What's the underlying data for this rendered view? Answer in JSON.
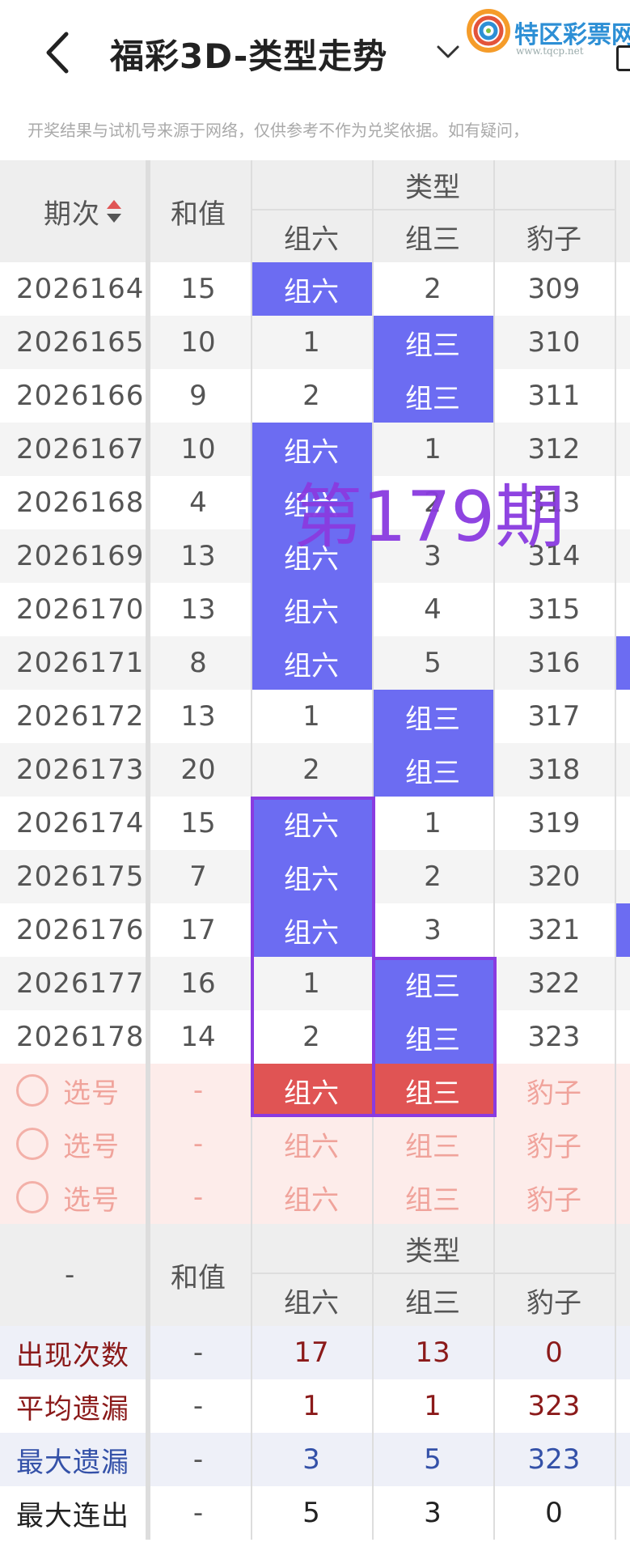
{
  "header": {
    "title": "福彩3D-类型走势",
    "logo_text": "特区彩票网",
    "logo_url": "www.tqcp.net"
  },
  "notice": "开奖结果与试机号来源于网络，仅供参考不作为兑奖依据。如有疑问，",
  "columns": {
    "issue": "期次",
    "sum": "和值",
    "type_group": "类型",
    "z6": "组六",
    "z3": "组三",
    "bz": "豹子"
  },
  "rows": [
    {
      "issue": "2026164",
      "sum": "15",
      "z6": "组六",
      "z3": "2",
      "bz": "309",
      "hit": "z6"
    },
    {
      "issue": "2026165",
      "sum": "10",
      "z6": "1",
      "z3": "组三",
      "bz": "310",
      "hit": "z3"
    },
    {
      "issue": "2026166",
      "sum": "9",
      "z6": "2",
      "z3": "组三",
      "bz": "311",
      "hit": "z3"
    },
    {
      "issue": "2026167",
      "sum": "10",
      "z6": "组六",
      "z3": "1",
      "bz": "312",
      "hit": "z6"
    },
    {
      "issue": "2026168",
      "sum": "4",
      "z6": "组六",
      "z3": "2",
      "bz": "313",
      "hit": "z6"
    },
    {
      "issue": "2026169",
      "sum": "13",
      "z6": "组六",
      "z3": "3",
      "bz": "314",
      "hit": "z6"
    },
    {
      "issue": "2026170",
      "sum": "13",
      "z6": "组六",
      "z3": "4",
      "bz": "315",
      "hit": "z6"
    },
    {
      "issue": "2026171",
      "sum": "8",
      "z6": "组六",
      "z3": "5",
      "bz": "316",
      "hit": "z6"
    },
    {
      "issue": "2026172",
      "sum": "13",
      "z6": "1",
      "z3": "组三",
      "bz": "317",
      "hit": "z3"
    },
    {
      "issue": "2026173",
      "sum": "20",
      "z6": "2",
      "z3": "组三",
      "bz": "318",
      "hit": "z3"
    },
    {
      "issue": "2026174",
      "sum": "15",
      "z6": "组六",
      "z3": "1",
      "bz": "319",
      "hit": "z6"
    },
    {
      "issue": "2026175",
      "sum": "7",
      "z6": "组六",
      "z3": "2",
      "bz": "320",
      "hit": "z6"
    },
    {
      "issue": "2026176",
      "sum": "17",
      "z6": "组六",
      "z3": "3",
      "bz": "321",
      "hit": "z6"
    },
    {
      "issue": "2026177",
      "sum": "16",
      "z6": "1",
      "z3": "组三",
      "bz": "322",
      "hit": "z3"
    },
    {
      "issue": "2026178",
      "sum": "14",
      "z6": "2",
      "z3": "组三",
      "bz": "323",
      "hit": "z3"
    }
  ],
  "pick_rows": [
    {
      "label": "选号",
      "sum": "-",
      "z6": "组六",
      "z3": "组三",
      "bz": "豹子"
    },
    {
      "label": "选号",
      "sum": "-",
      "z6": "组六",
      "z3": "组三",
      "bz": "豹子"
    },
    {
      "label": "选号",
      "sum": "-",
      "z6": "组六",
      "z3": "组三",
      "bz": "豹子"
    }
  ],
  "stats_header": {
    "issue": "-",
    "sum": "和值",
    "type_group": "类型",
    "z6": "组六",
    "z3": "组三",
    "bz": "豹子"
  },
  "stats": [
    {
      "label": "出现次数",
      "sum": "-",
      "z6": "17",
      "z3": "13",
      "bz": "0"
    },
    {
      "label": "平均遗漏",
      "sum": "-",
      "z6": "1",
      "z3": "1",
      "bz": "323"
    },
    {
      "label": "最大遗漏",
      "sum": "-",
      "z6": "3",
      "z3": "5",
      "bz": "323"
    },
    {
      "label": "最大连出",
      "sum": "-",
      "z6": "5",
      "z3": "3",
      "bz": "0"
    }
  ],
  "watermark": "第179期",
  "colors": {
    "hit_blue": "#6c6cf2",
    "hit_red": "#e05454",
    "box_purple": "#8a3be0"
  }
}
